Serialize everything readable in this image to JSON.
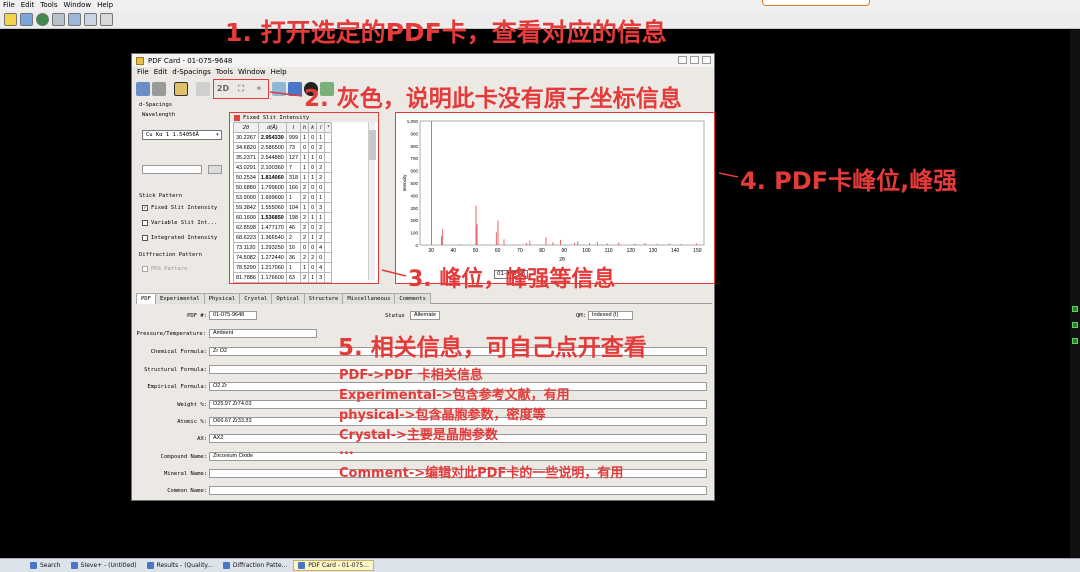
{
  "outer": {
    "menu": [
      "File",
      "Edit",
      "Tools",
      "Window",
      "Help"
    ]
  },
  "window": {
    "title": "PDF Card - 01-075-9648",
    "menu": [
      "File",
      "Edit",
      "d-Spacings",
      "Tools",
      "Window",
      "Help"
    ],
    "toolbar_2d": "2D"
  },
  "left_panel": {
    "section_title": "d-Spacings",
    "wavelength_label": "Wavelength",
    "wavelength_value": "Cu Kα 1  1.54056Å",
    "stick_pattern_label": "Stick Pattern",
    "options": [
      {
        "label": "Fixed Slit Intensity",
        "checked": true
      },
      {
        "label": "Variable Slit Int...",
        "checked": false
      },
      {
        "label": "Integrated Intensity",
        "checked": false
      }
    ],
    "diffraction_label": "Diffraction Pattern",
    "pdf_pattern_label": "PDS Pattern"
  },
  "table": {
    "header_label": "Fixed Slit Intensity",
    "columns": [
      "2θ",
      "d(Å)",
      "I",
      "h",
      "k",
      "l",
      "*"
    ],
    "rows": [
      [
        "30.2267",
        "2.954330",
        "999",
        "1",
        "0",
        "1",
        ""
      ],
      [
        "34.6820",
        "2.586500",
        "73",
        "0",
        "0",
        "2",
        ""
      ],
      [
        "35.2371",
        "2.544880",
        "127",
        "1",
        "1",
        "0",
        ""
      ],
      [
        "43.0291",
        "2.100360",
        "7",
        "1",
        "0",
        "2",
        ""
      ],
      [
        "50.2534",
        "1.814060",
        "318",
        "1",
        "1",
        "2",
        ""
      ],
      [
        "50.6880",
        "1.799600",
        "166",
        "2",
        "0",
        "0",
        ""
      ],
      [
        "53.9000",
        "1.699600",
        "1",
        "2",
        "0",
        "1",
        ""
      ],
      [
        "59.3842",
        "1.555060",
        "104",
        "1",
        "0",
        "3",
        ""
      ],
      [
        "60.1600",
        "1.536850",
        "198",
        "2",
        "1",
        "1",
        ""
      ],
      [
        "62.8598",
        "1.477170",
        "46",
        "2",
        "0",
        "2",
        ""
      ],
      [
        "68.6223",
        "1.366540",
        "2",
        "2",
        "1",
        "2",
        ""
      ],
      [
        "73.1120",
        "1.293250",
        "16",
        "0",
        "0",
        "4",
        ""
      ],
      [
        "74.5082",
        "1.272440",
        "36",
        "2",
        "2",
        "0",
        ""
      ],
      [
        "78.5290",
        "1.217060",
        "1",
        "1",
        "0",
        "4",
        ""
      ],
      [
        "81.7886",
        "1.176600",
        "63",
        "2",
        "1",
        "3",
        ""
      ]
    ],
    "bold_rows": [
      0,
      4,
      8
    ]
  },
  "chart_data": {
    "type": "bar",
    "xlabel": "2θ",
    "ylabel": "Intensity",
    "xlim": [
      25,
      153
    ],
    "ylim": [
      0,
      1000
    ],
    "xticks": [
      "30",
      "40",
      "50",
      "60",
      "70",
      "80",
      "90",
      "100",
      "110",
      "120",
      "130",
      "140",
      "150"
    ],
    "yticks": [
      "0",
      "100",
      "200",
      "300",
      "400",
      "500",
      "600",
      "700",
      "800",
      "900",
      "1,000"
    ],
    "series": [
      {
        "x": [
          30.2267,
          34.682,
          35.2371,
          43.0291,
          50.2534,
          50.688,
          53.9,
          59.3842,
          60.16,
          62.8598,
          68.6223,
          73.112,
          74.5082,
          78.529,
          81.7886,
          84.9,
          88.3,
          94.7,
          96.1,
          101.4,
          104.9,
          109.4,
          114.6,
          121.8,
          126.4,
          132.0,
          137.3,
          142.7,
          149.6
        ],
        "values": [
          999,
          73,
          127,
          7,
          318,
          166,
          1,
          104,
          198,
          46,
          2,
          16,
          36,
          1,
          63,
          22,
          41,
          18,
          30,
          14,
          25,
          12,
          20,
          11,
          17,
          9,
          13,
          8,
          11
        ]
      }
    ],
    "peak_search_value": "01-075-96"
  },
  "tabs": [
    "PDF",
    "Experimental",
    "Physical",
    "Crystal",
    "Optical",
    "Structure",
    "Miscellaneous",
    "Comments"
  ],
  "form": {
    "pdf_label": "PDF #:",
    "pdf_value": "01-075-9648",
    "status_label": "Status",
    "status_value": "Alternate",
    "qm_label": "QM:",
    "qm_value": "Indexed (I)",
    "pressure_label": "Pressure/Temperature:",
    "pressure_value": "Ambient",
    "chemical_label": "Chemical Formula:",
    "chemical_value": "Zr O2",
    "structural_label": "Structural Formula:",
    "structural_value": "",
    "empirical_label": "Empirical Formula:",
    "empirical_value": "O2 Zr",
    "weight_label": "Weight %:",
    "weight_value": "O25.97 Zr74.03",
    "atomic_label": "Atomic %:",
    "atomic_value": "O66.67 Zr33.33",
    "ax_label": "AX:",
    "ax_value": "AX2",
    "compound_label": "Compound Name:",
    "compound_value": "Zirconium Oxide",
    "mineral_label": "Mineral Name:",
    "mineral_value": "",
    "common_label": "Common Name:",
    "common_value": ""
  },
  "annotations": {
    "a1": "1. 打开选定的PDF卡，查看对应的信息",
    "a2": "2. 灰色，说明此卡没有原子坐标信息",
    "a3": "3. 峰位，峰强等信息",
    "a4": "4. PDF卡峰位,峰强",
    "a5": "5. 相关信息，可自己点开查看",
    "notes": [
      "PDF->PDF 卡相关信息",
      "Experimental->包含参考文献，有用",
      "physical->包含晶胞参数，密度等",
      "Crystal->主要是晶胞参数",
      "...",
      "Comment->编辑对此PDF卡的一些说明，有用"
    ],
    "color": "#e53a3a"
  },
  "taskbar": [
    {
      "label": "Search",
      "active": false
    },
    {
      "label": "SIeve+ - (Untitled)",
      "active": false
    },
    {
      "label": "Results - (Quality...",
      "active": false
    },
    {
      "label": "Diffraction Patte...",
      "active": false
    },
    {
      "label": "PDF Card - 01-075...",
      "active": true
    }
  ]
}
